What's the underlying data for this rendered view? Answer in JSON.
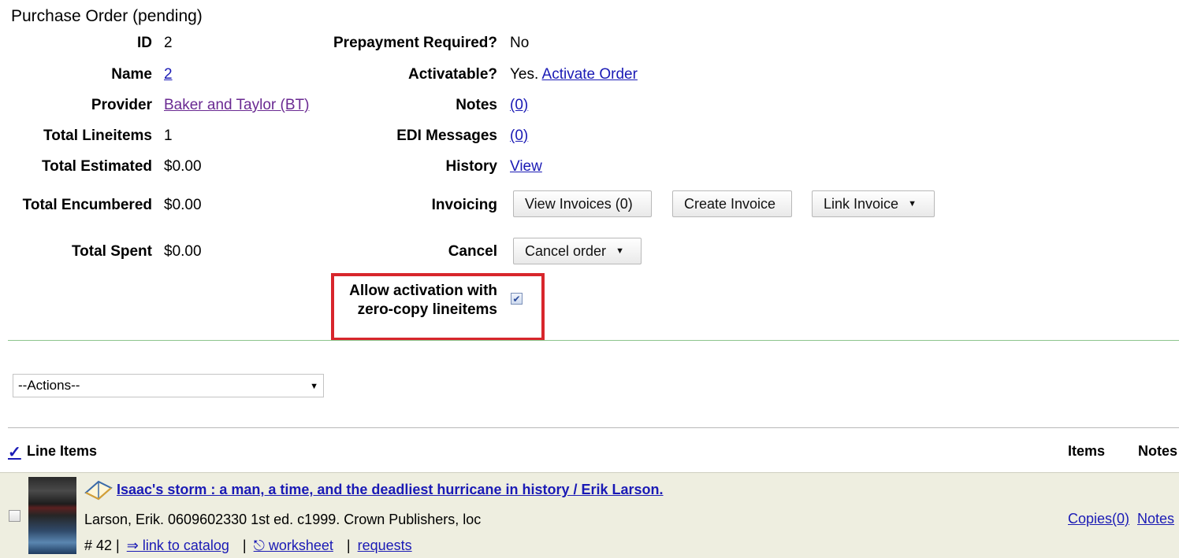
{
  "page_title": "Purchase Order (pending)",
  "fields_left": [
    {
      "label": "ID",
      "value": "2"
    },
    {
      "label": "Name",
      "value": "2"
    },
    {
      "label": "Provider",
      "value": "Baker and Taylor (BT)"
    },
    {
      "label": "Total Lineitems",
      "value": "1"
    },
    {
      "label": "Total Estimated",
      "value": "$0.00"
    },
    {
      "label": "Total Encumbered",
      "value": "$0.00"
    },
    {
      "label": "Total Spent",
      "value": "$0.00"
    }
  ],
  "fields_mid": {
    "prepayment_label": "Prepayment Required?",
    "prepayment_value": "No",
    "activatable_label": "Activatable?",
    "activatable_value": "Yes.",
    "activate_link": "Activate Order",
    "notes_label": "Notes",
    "notes_link": "(0)",
    "edi_label": "EDI Messages",
    "edi_link": "(0)",
    "history_label": "History",
    "history_link": "View",
    "invoicing_label": "Invoicing",
    "cancel_label": "Cancel",
    "zero_copy_line1": "Allow activation with",
    "zero_copy_line2": "zero-copy lineitems",
    "zero_copy_checked": true
  },
  "buttons": {
    "view_invoices": "View Invoices (0)",
    "create_invoice": "Create Invoice",
    "link_invoice": "Link Invoice",
    "cancel_order": "Cancel order"
  },
  "actions_select": "--Actions--",
  "line_items": {
    "check_glyph": "✓",
    "header": "Line Items",
    "col_items": "Items",
    "col_notes": "Notes",
    "rows": [
      {
        "title": "Isaac's storm : a man, a time, and the deadliest hurricane in history / Erik Larson.",
        "details": "Larson, Erik. 0609602330 1st ed. c1999. Crown Publishers, loc",
        "number": "# 42 |",
        "catalog_link": "⇒ link to catalog",
        "sep1": "|",
        "worksheet_link": "⎋ worksheet",
        "sep2": "|",
        "requests_link": "requests",
        "copies_link": "Copies(0)",
        "notes_link": "Notes"
      }
    ]
  },
  "colors": {
    "link": "#1a1ab5",
    "visited_link": "#6a2a92",
    "highlight_border": "#d8262c",
    "row_bg": "#eeeee0",
    "divider_green": "#8cc48c"
  }
}
